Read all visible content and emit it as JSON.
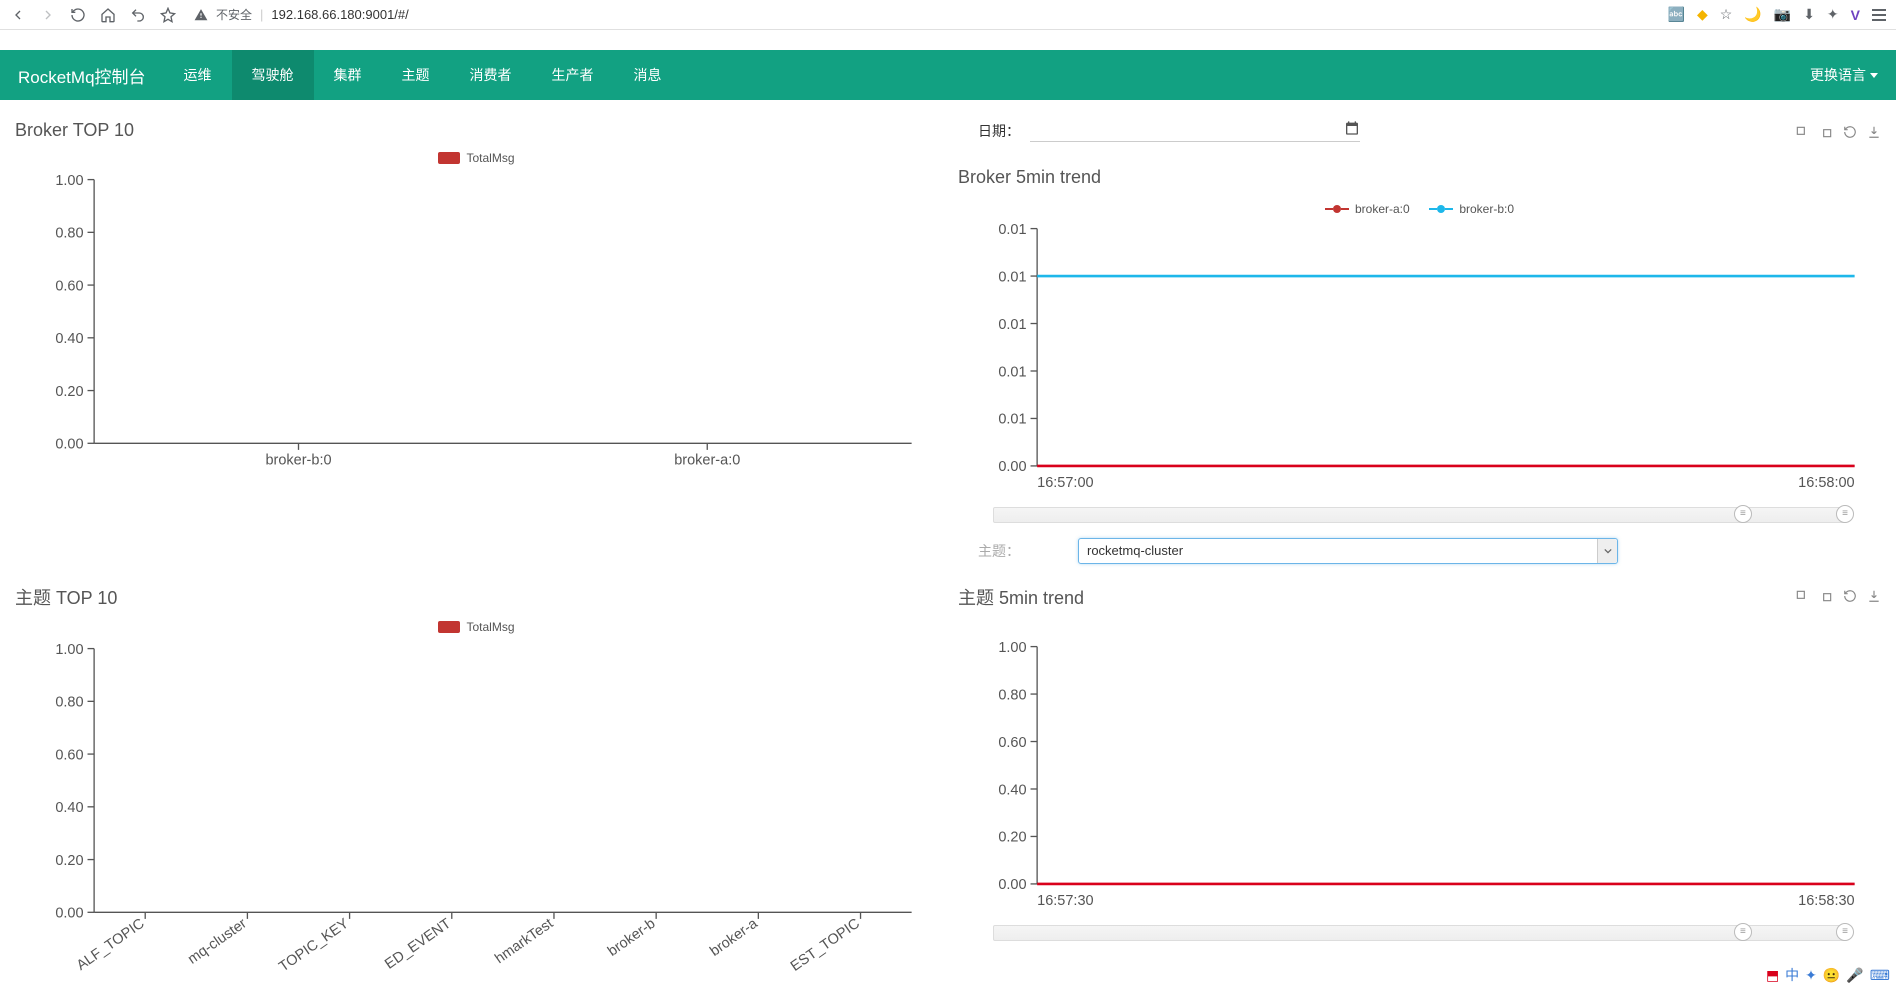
{
  "browser": {
    "insecure_label": "不安全",
    "url": "192.168.66.180:9001/#/"
  },
  "nav": {
    "title": "RocketMq控制台",
    "items": [
      "运维",
      "驾驶舱",
      "集群",
      "主题",
      "消费者",
      "生产者",
      "消息"
    ],
    "active_index": 1,
    "lang_label": "更换语言"
  },
  "date": {
    "label": "日期：",
    "value": ""
  },
  "topic_select": {
    "label": "主题：",
    "value": "rocketmq-cluster"
  },
  "chart1": {
    "title": "Broker TOP 10",
    "legend": "TotalMsg"
  },
  "chart2": {
    "title": "Broker 5min trend",
    "legend_a": "broker-a:0",
    "legend_b": "broker-b:0"
  },
  "chart3": {
    "title": "主题 TOP 10",
    "legend": "TotalMsg"
  },
  "chart4": {
    "title": "主题 5min trend"
  },
  "chart_data": [
    {
      "type": "bar",
      "title": "Broker TOP 10",
      "legend": [
        "TotalMsg"
      ],
      "categories": [
        "broker-b:0",
        "broker-a:0"
      ],
      "values": [
        0,
        0
      ],
      "ylim": [
        0,
        1
      ],
      "yticks": [
        0.0,
        0.2,
        0.4,
        0.6,
        0.8,
        1.0
      ]
    },
    {
      "type": "line",
      "title": "Broker 5min trend",
      "x": [
        "16:57:00",
        "16:58:00"
      ],
      "series": [
        {
          "name": "broker-a:0",
          "color": "#d9001b",
          "values": [
            0,
            0
          ]
        },
        {
          "name": "broker-b:0",
          "color": "#1db7ea",
          "values": [
            0.008,
            0.008
          ]
        }
      ],
      "ylim": [
        0,
        0.01
      ],
      "yticks": [
        0.0,
        0.01,
        0.01,
        0.01,
        0.01,
        0.01
      ]
    },
    {
      "type": "bar",
      "title": "主题 TOP 10",
      "legend": [
        "TotalMsg"
      ],
      "categories": [
        "ALF_TOPIC",
        "mq-cluster",
        "TOPIC_KEY",
        "ED_EVENT",
        "hmarkTest",
        "broker-b",
        "broker-a",
        "EST_TOPIC"
      ],
      "values": [
        0,
        0,
        0,
        0,
        0,
        0,
        0,
        0
      ],
      "ylim": [
        0,
        1
      ],
      "yticks": [
        0.0,
        0.2,
        0.4,
        0.6,
        0.8,
        1.0
      ]
    },
    {
      "type": "line",
      "title": "主题 5min trend",
      "x": [
        "16:57:30",
        "16:58:30"
      ],
      "series": [
        {
          "name": "rocketmq-cluster",
          "color": "#d9001b",
          "values": [
            0,
            0
          ]
        }
      ],
      "ylim": [
        0,
        1
      ],
      "yticks": [
        0.0,
        0.2,
        0.4,
        0.6,
        0.8,
        1.0
      ]
    }
  ]
}
